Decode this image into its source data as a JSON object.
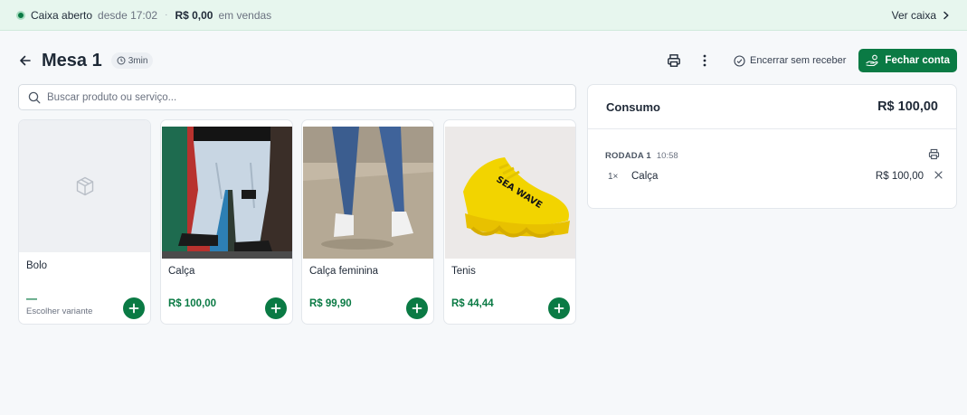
{
  "status_bar": {
    "status": "Caixa aberto",
    "since": "desde 17:02",
    "separator": "·",
    "sales_amount": "R$ 0,00",
    "sales_label": "em vendas",
    "view_link": "Ver caixa"
  },
  "header": {
    "title": "Mesa 1",
    "elapsed": "3min",
    "close_without_pay_label": "Encerrar sem receber",
    "close_bill_label": "Fechar conta"
  },
  "search": {
    "placeholder": "Buscar produto ou serviço..."
  },
  "products": [
    {
      "name": "Bolo",
      "price": "—",
      "subtitle": "Escolher variante",
      "image": "box-icon"
    },
    {
      "name": "Calça",
      "price": "R$ 100,00",
      "image": "cargo-pants-photo"
    },
    {
      "name": "Calça feminina",
      "price": "R$ 99,90",
      "image": "jeans-photo"
    },
    {
      "name": "Tenis",
      "price": "R$ 44,44",
      "image": "yellow-sneaker-photo",
      "brand_text": "SEA WAVE"
    }
  ],
  "consumo": {
    "title": "Consumo",
    "total": "R$ 100,00",
    "rounds": [
      {
        "label": "RODADA 1",
        "time": "10:58",
        "items": [
          {
            "qty": "1×",
            "name": "Calça",
            "price": "R$ 100,00"
          }
        ]
      }
    ]
  },
  "colors": {
    "brand_green": "#0a7a44",
    "status_bg": "#e7f6ee",
    "page_bg": "#f6f8fa"
  }
}
